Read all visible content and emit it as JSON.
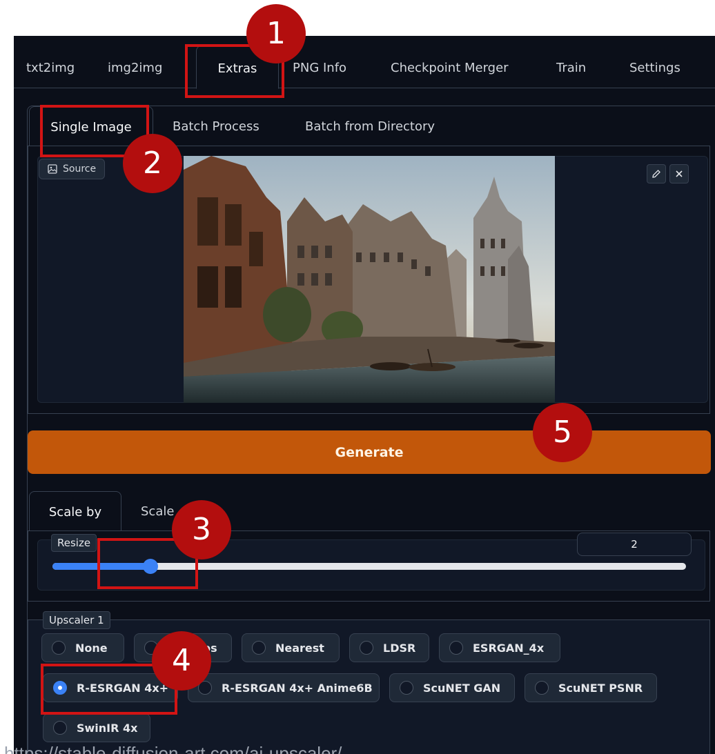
{
  "main_tabs": [
    {
      "label": "txt2img"
    },
    {
      "label": "img2img"
    },
    {
      "label": "Extras",
      "active": true
    },
    {
      "label": "PNG Info"
    },
    {
      "label": "Checkpoint Merger"
    },
    {
      "label": "Train"
    },
    {
      "label": "Settings"
    }
  ],
  "sub_tabs": [
    {
      "label": "Single Image",
      "active": true
    },
    {
      "label": "Batch Process"
    },
    {
      "label": "Batch from Directory"
    }
  ],
  "source": {
    "label": "Source",
    "icon": "image-icon",
    "edit_icon": "pencil-icon",
    "close_icon": "close-icon"
  },
  "generate_label": "Generate",
  "scale_tabs": [
    {
      "label": "Scale by",
      "active": true
    },
    {
      "label": "Scale"
    }
  ],
  "resize": {
    "label": "Resize",
    "value": "2",
    "slider_fraction": 0.155
  },
  "upscaler": {
    "label": "Upscaler 1",
    "options": [
      {
        "label": "None"
      },
      {
        "label": "Lanczos"
      },
      {
        "label": "Nearest"
      },
      {
        "label": "LDSR"
      },
      {
        "label": "ESRGAN_4x"
      },
      {
        "label": "R-ESRGAN 4x+",
        "checked": true
      },
      {
        "label": "R-ESRGAN 4x+ Anime6B"
      },
      {
        "label": "ScuNET GAN"
      },
      {
        "label": "ScuNET PSNR"
      },
      {
        "label": "SwinIR 4x"
      }
    ]
  },
  "markers": [
    "1",
    "2",
    "3",
    "4",
    "5"
  ],
  "source_url": "https://stable-diffusion-art.com/ai-upscaler/",
  "colors": {
    "background": "#0b0f19",
    "generate": "#c2570a",
    "accent": "#3b82f6",
    "highlight": "#d21414",
    "marker": "#b30e0e"
  }
}
